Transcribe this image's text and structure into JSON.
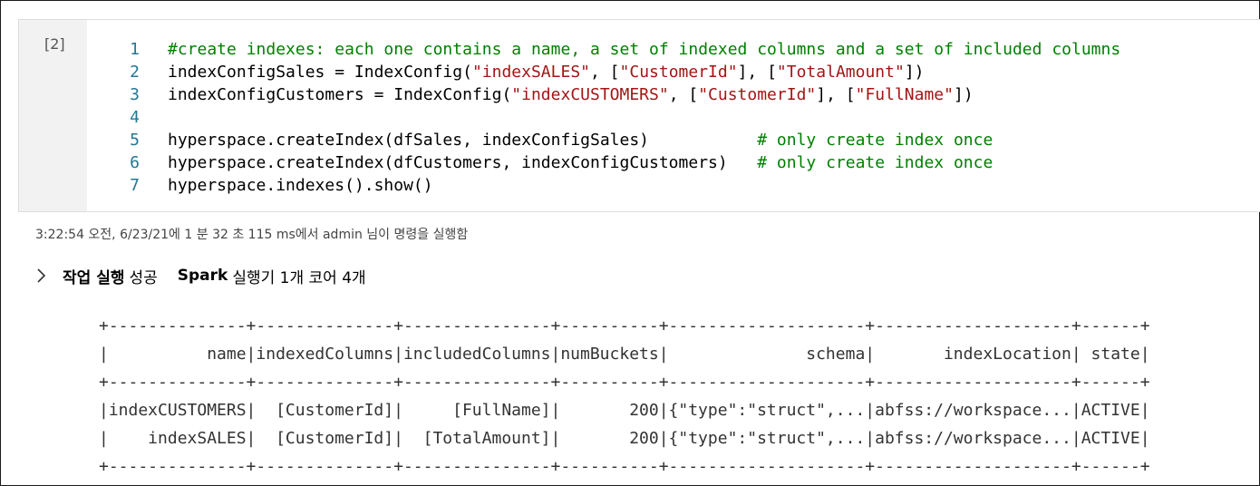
{
  "cell": {
    "execution_count": "[2]",
    "code_lines": [
      {
        "num": "1",
        "tokens": [
          {
            "t": "#create indexes: each one contains a name, a set of indexed columns and a set of included columns",
            "k": "comment"
          }
        ]
      },
      {
        "num": "2",
        "tokens": [
          {
            "t": "indexConfigSales = IndexConfig(",
            "k": "plain"
          },
          {
            "t": "\"indexSALES\"",
            "k": "string"
          },
          {
            "t": ", [",
            "k": "plain"
          },
          {
            "t": "\"CustomerId\"",
            "k": "string"
          },
          {
            "t": "], [",
            "k": "plain"
          },
          {
            "t": "\"TotalAmount\"",
            "k": "string"
          },
          {
            "t": "])",
            "k": "plain"
          }
        ]
      },
      {
        "num": "3",
        "tokens": [
          {
            "t": "indexConfigCustomers = IndexConfig(",
            "k": "plain"
          },
          {
            "t": "\"indexCUSTOMERS\"",
            "k": "string"
          },
          {
            "t": ", [",
            "k": "plain"
          },
          {
            "t": "\"CustomerId\"",
            "k": "string"
          },
          {
            "t": "], [",
            "k": "plain"
          },
          {
            "t": "\"FullName\"",
            "k": "string"
          },
          {
            "t": "])",
            "k": "plain"
          }
        ]
      },
      {
        "num": "4",
        "tokens": []
      },
      {
        "num": "5",
        "tokens": [
          {
            "t": "hyperspace.createIndex(dfSales, indexConfigSales)           ",
            "k": "plain"
          },
          {
            "t": "# only create index once",
            "k": "comment"
          }
        ]
      },
      {
        "num": "6",
        "tokens": [
          {
            "t": "hyperspace.createIndex(dfCustomers, indexConfigCustomers)   ",
            "k": "plain"
          },
          {
            "t": "# only create index once",
            "k": "comment"
          }
        ]
      },
      {
        "num": "7",
        "tokens": [
          {
            "t": "hyperspace.indexes().show()",
            "k": "plain"
          }
        ]
      }
    ]
  },
  "status": {
    "text": "3:22:54 오전, 6/23/21에 1 분 32 초 115 ms에서 admin 님이 명령을 실행함"
  },
  "job": {
    "label": "작업 실행",
    "result": "성공",
    "spark_label": "Spark",
    "executor_info": "실행기 1개 코어 4개"
  },
  "output": {
    "lines": [
      "+--------------+--------------+---------------+----------+--------------------+--------------------+------+",
      "|          name|indexedColumns|includedColumns|numBuckets|              schema|       indexLocation| state|",
      "+--------------+--------------+---------------+----------+--------------------+--------------------+------+",
      "|indexCUSTOMERS|  [CustomerId]|     [FullName]|       200|{\"type\":\"struct\",...|abfss://workspace...|ACTIVE|",
      "|    indexSALES|  [CustomerId]|  [TotalAmount]|       200|{\"type\":\"struct\",...|abfss://workspace...|ACTIVE|",
      "+--------------+--------------+---------------+----------+--------------------+--------------------+------+"
    ]
  },
  "colors": {
    "comment": "#008000",
    "string": "#a31515",
    "line_number": "#237893",
    "cell_background": "#f2f2f2"
  },
  "icons": {
    "expand": "chevron-right-icon"
  }
}
